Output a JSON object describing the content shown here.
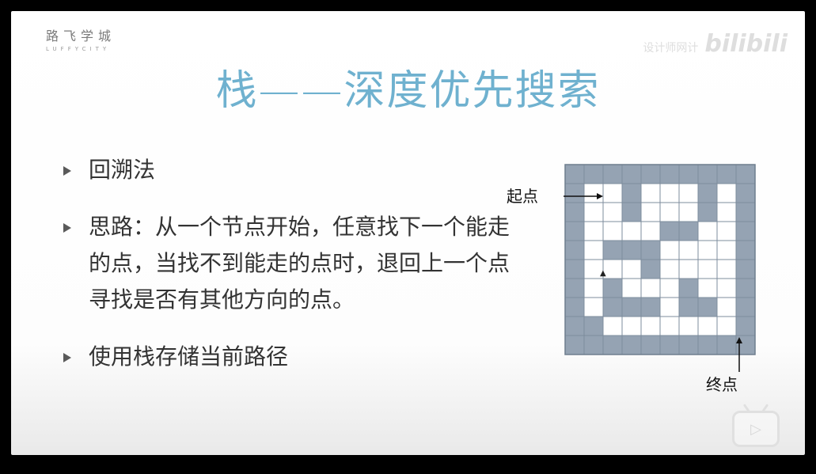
{
  "logo": {
    "cn": "路飞学城",
    "en": "LUFFYCITY"
  },
  "watermark": {
    "text": "设计师网计",
    "brand": "bilibili"
  },
  "title": "栈——深度优先搜索",
  "bullets": [
    {
      "text": "回溯法"
    },
    {
      "text": "思路：从一个节点开始，任意找下一个能走的点，当找不到能走的点时，退回上一个点寻找是否有其他方向的点。"
    },
    {
      "text": "使用栈存储当前路径"
    }
  ],
  "maze": {
    "start_label": "起点",
    "end_label": "终点",
    "wall_color": "#95a3b3",
    "open_color": "#ffffff",
    "grid": [
      [
        1,
        1,
        1,
        1,
        1,
        1,
        1,
        1,
        1,
        1
      ],
      [
        1,
        0,
        0,
        1,
        0,
        0,
        0,
        1,
        0,
        1
      ],
      [
        1,
        0,
        0,
        1,
        0,
        0,
        0,
        1,
        0,
        1
      ],
      [
        1,
        0,
        0,
        0,
        0,
        1,
        1,
        0,
        0,
        1
      ],
      [
        1,
        0,
        1,
        1,
        1,
        0,
        0,
        0,
        0,
        1
      ],
      [
        1,
        0,
        0,
        0,
        1,
        0,
        0,
        0,
        0,
        1
      ],
      [
        1,
        0,
        1,
        0,
        0,
        0,
        1,
        0,
        0,
        1
      ],
      [
        1,
        0,
        1,
        1,
        1,
        0,
        1,
        1,
        0,
        1
      ],
      [
        1,
        1,
        0,
        0,
        0,
        0,
        0,
        0,
        0,
        1
      ],
      [
        1,
        1,
        1,
        1,
        1,
        1,
        1,
        1,
        1,
        1
      ]
    ]
  },
  "play_icon": "play-icon"
}
